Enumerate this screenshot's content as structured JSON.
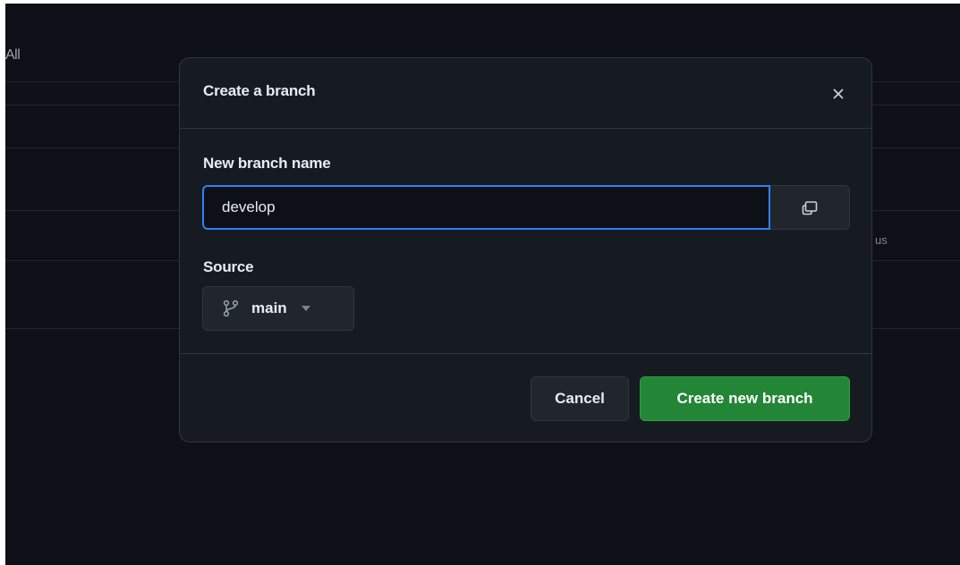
{
  "background": {
    "filter_label": "All",
    "column_fragment": "us"
  },
  "dialog": {
    "title": "Create a branch",
    "close_icon": "close-icon",
    "branch_name": {
      "label": "New branch name",
      "value": "develop",
      "copy_icon": "copy-icon"
    },
    "source": {
      "label": "Source",
      "branch_icon": "git-branch-icon",
      "selected": "main",
      "dropdown_icon": "triangle-down-icon"
    },
    "cancel_label": "Cancel",
    "create_label": "Create new branch"
  },
  "colors": {
    "page_background": "#0d1117",
    "dialog_background": "#161b22",
    "border": "#30363d",
    "focus_ring": "#2f81f7",
    "primary_button": "#238636",
    "text": "#e6edf3",
    "muted_text": "#7d8590"
  }
}
